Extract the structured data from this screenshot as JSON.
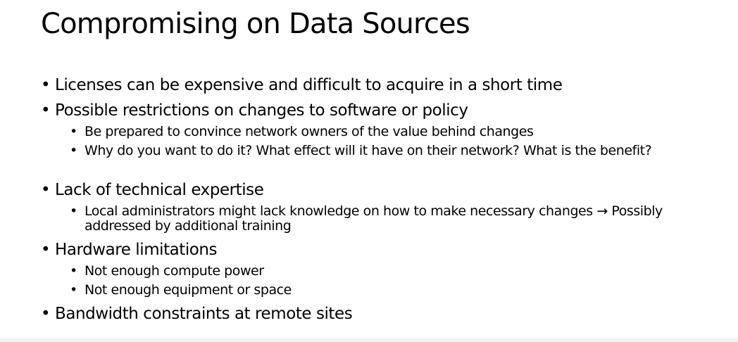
{
  "slide": {
    "title": "Compromising on Data Sources",
    "bullet_glyph": "•",
    "items": [
      {
        "text": "Licenses can be expensive and difficult to acquire in a short time",
        "subitems": []
      },
      {
        "text": "Possible restrictions on changes to software or policy",
        "subitems": [
          "Be prepared to convince network owners of the value behind changes",
          "Why do you want to do it? What effect will it have on their network? What is the benefit?"
        ]
      },
      {
        "text": "Lack of technical expertise",
        "subitems": [
          "Local administrators might lack knowledge on how to make necessary changes → Possibly addressed by additional training"
        ]
      },
      {
        "text": "Hardware limitations",
        "subitems": [
          "Not enough compute power",
          "Not enough equipment or space"
        ]
      },
      {
        "text": "Bandwidth constraints at remote sites",
        "subitems": []
      }
    ]
  }
}
